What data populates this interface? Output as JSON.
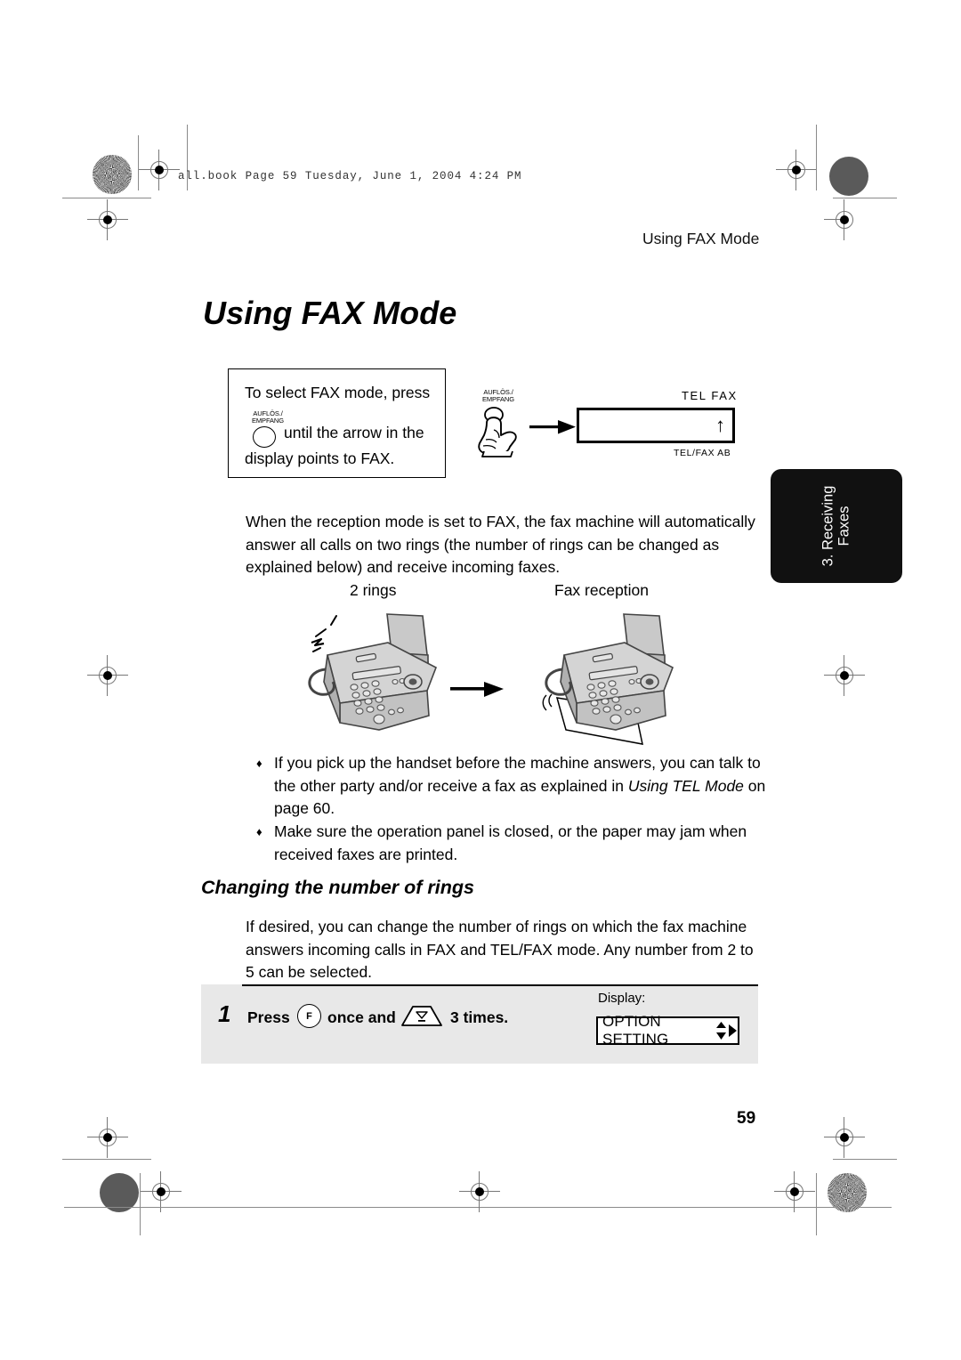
{
  "slug": "all.book  Page 59  Tuesday, June 1, 2004  4:24 PM",
  "running_head": "Using FAX Mode",
  "chapter_tab": {
    "line1": "3. Receiving",
    "line2": "Faxes"
  },
  "title": "Using FAX Mode",
  "callout": {
    "line1": "To select FAX mode, press",
    "key_label_line1": "AUFLÖS./",
    "key_label_line2": "EMPFANG",
    "line2": "until the arrow in the",
    "line3": "display points to FAX."
  },
  "hand_art": {
    "key_label_line1": "AUFLÖS./",
    "key_label_line2": "EMPFANG"
  },
  "lcd_art": {
    "top_label": "TEL  FAX",
    "bottom_label": "TEL/FAX  AB",
    "arrow": "↑"
  },
  "body_paragraph": "When the reception mode is set to FAX, the fax machine will automatically answer all calls on two rings (the number of rings can be changed as explained below) and receive incoming faxes.",
  "figure_captions": {
    "left": "2 rings",
    "right": "Fax reception"
  },
  "bullets": [
    {
      "symbol": "♦",
      "text_before": "If you pick up the handset before the machine answers, you can talk to the other party and/or receive a fax as explained in ",
      "italic": "Using TEL Mode",
      "text_after": " on page 60."
    },
    {
      "symbol": "♦",
      "text_before": "Make sure the operation panel is closed, or the paper may jam when received faxes are printed.",
      "italic": "",
      "text_after": ""
    }
  ],
  "section": {
    "heading": "Changing the number of rings",
    "paragraph": "If desired, you can change the number of rings on which the fax machine answers incoming calls in FAX and TEL/FAX mode. Any number from 2 to 5 can be selected."
  },
  "step": {
    "number": "1",
    "text_press": "Press",
    "fkey_label": "F",
    "text_middle": "once and",
    "text_end": "3 times.",
    "display_label": "Display:",
    "display_value": "OPTION SETTING"
  },
  "page_number": "59"
}
